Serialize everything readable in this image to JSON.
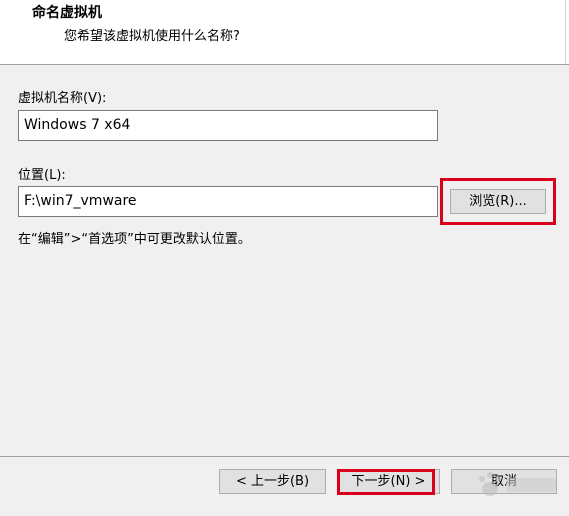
{
  "header": {
    "title": "命名虚拟机",
    "subtitle": "您希望该虚拟机使用什么名称?"
  },
  "name_field": {
    "label": "虚拟机名称(V):",
    "value": "Windows 7 x64"
  },
  "location_field": {
    "label": "位置(L):",
    "value": "F:\\win7_vmware",
    "browse_label": "浏览(R)...",
    "hint": "在“编辑”>“首选项”中可更改默认位置。"
  },
  "footer": {
    "back_label": "< 上一步(B)",
    "next_label": "下一步(N) >",
    "cancel_label": "取消"
  },
  "colors": {
    "highlight": "#d9001b",
    "panel": "#f0f0f0",
    "button": "#e1e1e1"
  }
}
